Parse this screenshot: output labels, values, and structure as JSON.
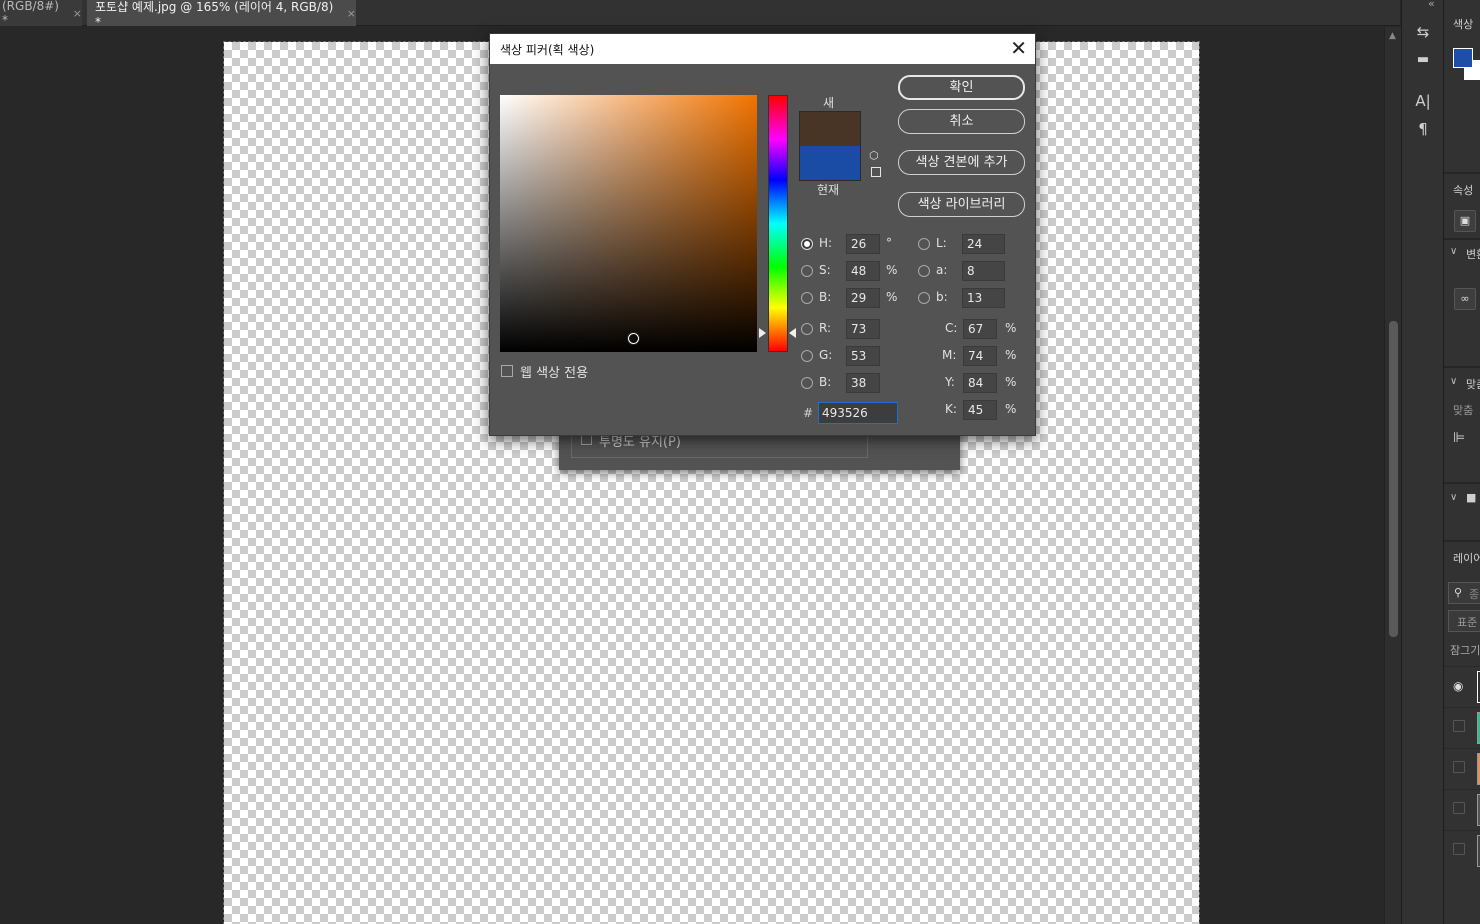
{
  "tabs": [
    {
      "label": "(RGB/8#) *",
      "close": "×"
    },
    {
      "label": "포토샵 예제.jpg @ 165% (레이어 4, RGB/8) *",
      "close": "×"
    }
  ],
  "right_panel": {
    "color_label": "색상",
    "properties_label": "속성",
    "transform_label": "변환",
    "align_label": "맞춤",
    "align_sub": "맞춤",
    "layers_label": "레이어",
    "layers_search": "종",
    "layers_mode": "표준",
    "lock_label": "잠그기"
  },
  "colors": {
    "foreground": "#1d4fa6",
    "new": "#493526",
    "current": "#1a4ca5"
  },
  "behind_dialog": {
    "checkbox_label": "투명도 유지(P)"
  },
  "dialog": {
    "title": "색상 피커(획 색상)",
    "close": "✕",
    "new_label": "새",
    "current_label": "현재",
    "buttons": {
      "ok": "확인",
      "cancel": "취소",
      "add_swatch": "색상 견본에 추가",
      "libraries": "색상 라이브러리"
    },
    "web_only_label": "웹 색상 전용",
    "hsb": [
      {
        "label": "H:",
        "value": "26",
        "unit": "°",
        "selected": true
      },
      {
        "label": "S:",
        "value": "48",
        "unit": "%",
        "selected": false
      },
      {
        "label": "B:",
        "value": "29",
        "unit": "%",
        "selected": false
      }
    ],
    "lab": [
      {
        "label": "L:",
        "value": "24"
      },
      {
        "label": "a:",
        "value": "8"
      },
      {
        "label": "b:",
        "value": "13"
      }
    ],
    "rgb": [
      {
        "label": "R:",
        "value": "73"
      },
      {
        "label": "G:",
        "value": "53"
      },
      {
        "label": "B:",
        "value": "38"
      }
    ],
    "cmyk": [
      {
        "label": "C:",
        "value": "67",
        "unit": "%"
      },
      {
        "label": "M:",
        "value": "74",
        "unit": "%"
      },
      {
        "label": "Y:",
        "value": "84",
        "unit": "%"
      },
      {
        "label": "K:",
        "value": "45",
        "unit": "%"
      }
    ],
    "hex_label": "#",
    "hex": "493526"
  }
}
